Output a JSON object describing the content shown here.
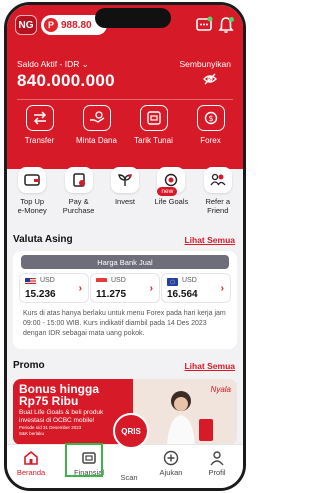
{
  "header": {
    "ng_badge": "NG",
    "points_icon": "P",
    "points": "988.80",
    "balance_label": "Saldo Aktif - IDR ⌄",
    "hide_label": "Sembunyikan",
    "balance_value": "840.000.000"
  },
  "actions": [
    {
      "label": "Transfer",
      "icon": "transfer-icon"
    },
    {
      "label": "Minta Dana",
      "icon": "request-money-icon"
    },
    {
      "label": "Tarik Tunai",
      "icon": "withdraw-cash-icon"
    },
    {
      "label": "Forex",
      "icon": "forex-icon"
    }
  ],
  "menu": [
    {
      "label": "Top Up\ne-Money",
      "icon": "wallet-icon"
    },
    {
      "label": "Pay &\nPurchase",
      "icon": "receipt-icon"
    },
    {
      "label": "Invest",
      "icon": "sprout-icon"
    },
    {
      "label": "Life Goals",
      "icon": "target-icon",
      "badge": "new"
    },
    {
      "label": "Refer a\nFriend",
      "icon": "people-icon"
    }
  ],
  "valuta": {
    "title": "Valuta Asing",
    "see_all": "Lihat Semua",
    "tab": "Harga Bank Jual",
    "rates": [
      {
        "currency": "USD",
        "value": "15.236",
        "flag": "us-flag-icon"
      },
      {
        "currency": "USD",
        "value": "11.275",
        "flag": "sg-flag-icon"
      },
      {
        "currency": "USD",
        "value": "16.564",
        "flag": "eu-flag-icon"
      }
    ],
    "note": "Kurs di atas hanya berlaku untuk menu Forex pada hari kerja jam 09:00 - 15:00 WIB. Kurs indikatif diambil pada 14 Des 2023 dengan IDR sebagai mata uang pokok."
  },
  "promo": {
    "title": "Promo",
    "see_all": "Lihat Semua",
    "headline": "Bonus hingga Rp75 Ribu",
    "sub": "Buat Life Goals & beli produk investasi di OCBC mobile!",
    "period": "Periode s/d 31 Desember 2023",
    "tc": "S&K berlaku",
    "script": "Nyala"
  },
  "bottom_nav": [
    {
      "label": "Beranda",
      "icon": "home-icon",
      "active": true
    },
    {
      "label": "Finansial",
      "icon": "finance-icon"
    },
    {
      "label": "Scan",
      "icon": "scan-icon"
    },
    {
      "label": "Ajukan",
      "icon": "plus-circle-icon"
    },
    {
      "label": "Profil",
      "icon": "profile-icon"
    }
  ],
  "qris_label": "QRIS",
  "colors": {
    "brand_red": "#d71a28",
    "highlight_green": "#3bb54a"
  }
}
